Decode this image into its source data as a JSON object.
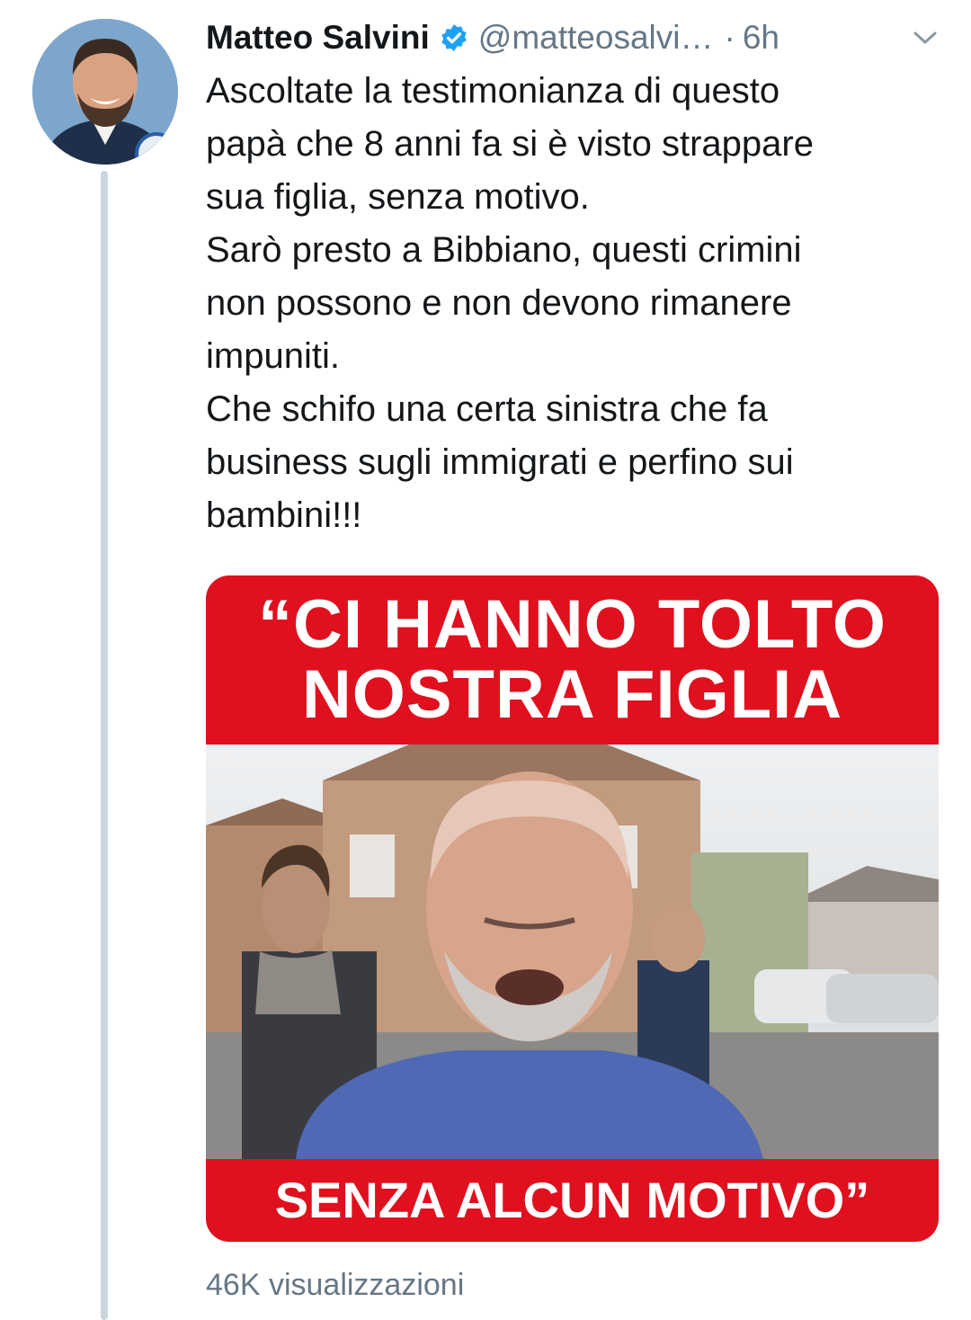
{
  "tweet": {
    "author_name": "Matteo Salvini",
    "handle": "@matteosalvi…",
    "separator": "·",
    "time": "6h",
    "text": "Ascoltate la testimonianza di questo\npapà che 8 anni fa si è visto strappare\nsua figlia, senza motivo.\nSarò presto a Bibbiano, questi crimini\nnon possono e non devono rimanere\nimpuniti.\nChe schifo una certa sinistra che fa\nbusiness sugli immigrati e perfino sui\nbambini!!!",
    "views": "46K visualizzazioni"
  },
  "media": {
    "headline_line1": "“CI HANNO TOLTO",
    "headline_line2": "NOSTRA FIGLIA",
    "caption": "SENZA ALCUN MOTIVO”",
    "banner_color": "#e0101e"
  },
  "icons": {
    "verified": "verified-badge-icon",
    "menu": "chevron-down-icon"
  },
  "colors": {
    "verified": "#1da1f2",
    "secondary_text": "#657786",
    "thread_line": "#c9d6df"
  }
}
